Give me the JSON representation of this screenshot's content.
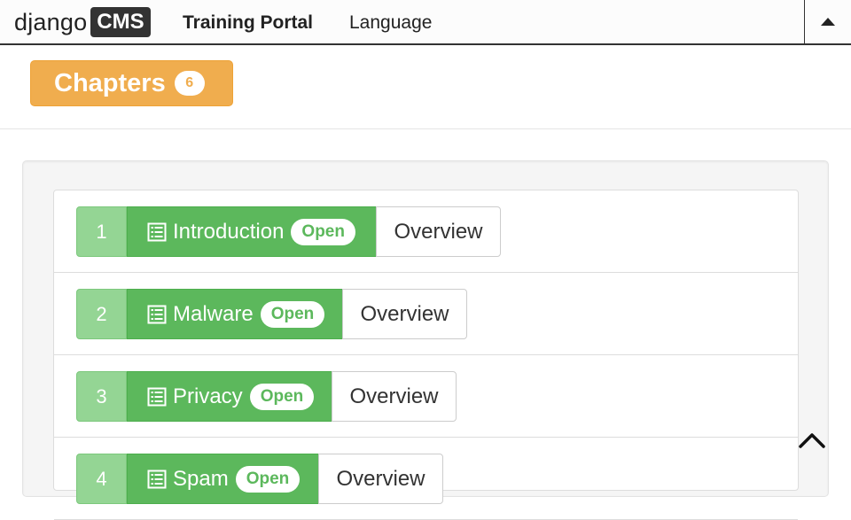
{
  "navbar": {
    "logo_text": "django",
    "logo_badge": "CMS",
    "brand": "Training Portal",
    "language": "Language",
    "toggle_icon": "caret-up-icon"
  },
  "header": {
    "chapters_label": "Chapters",
    "chapters_count": "6"
  },
  "chapters": [
    {
      "number": "1",
      "title": "Introduction",
      "status": "Open",
      "action": "Overview"
    },
    {
      "number": "2",
      "title": "Malware",
      "status": "Open",
      "action": "Overview"
    },
    {
      "number": "3",
      "title": "Privacy",
      "status": "Open",
      "action": "Overview"
    },
    {
      "number": "4",
      "title": "Spam",
      "status": "Open",
      "action": "Overview"
    }
  ],
  "icons": {
    "chapter_icon": "list-alt-icon",
    "scroll_top": "chevron-up-icon"
  },
  "colors": {
    "chapters_orange": "#f0ad4e",
    "success_green": "#5cb85c",
    "number_green": "#94d594"
  }
}
